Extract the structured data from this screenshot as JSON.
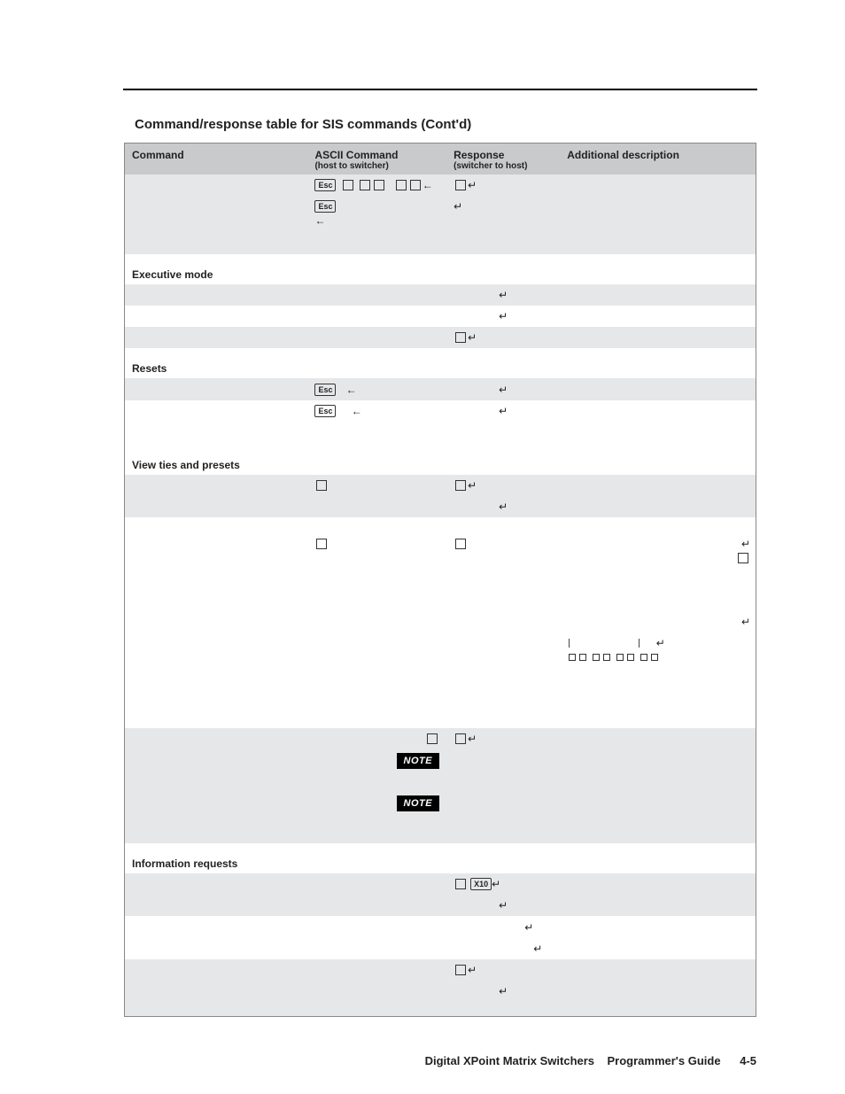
{
  "page_title": "Command/response table for SIS commands (Cont'd)",
  "headers": {
    "c1": "Command",
    "c2": "ASCII Command",
    "c2s": "(host to switcher)",
    "c3": "Response",
    "c3s": "(switcher to host)",
    "c4": "Additional description"
  },
  "sections": {
    "exec": "Executive mode",
    "resets": "Resets",
    "view": "View ties and presets",
    "info": "Information requests"
  },
  "labels": {
    "esc": "Esc",
    "x10": "X10",
    "note": "NOTE"
  },
  "footer": {
    "left": "Digital XPoint Matrix Switchers",
    "right": "Programmer's Guide",
    "page": "4-5"
  }
}
